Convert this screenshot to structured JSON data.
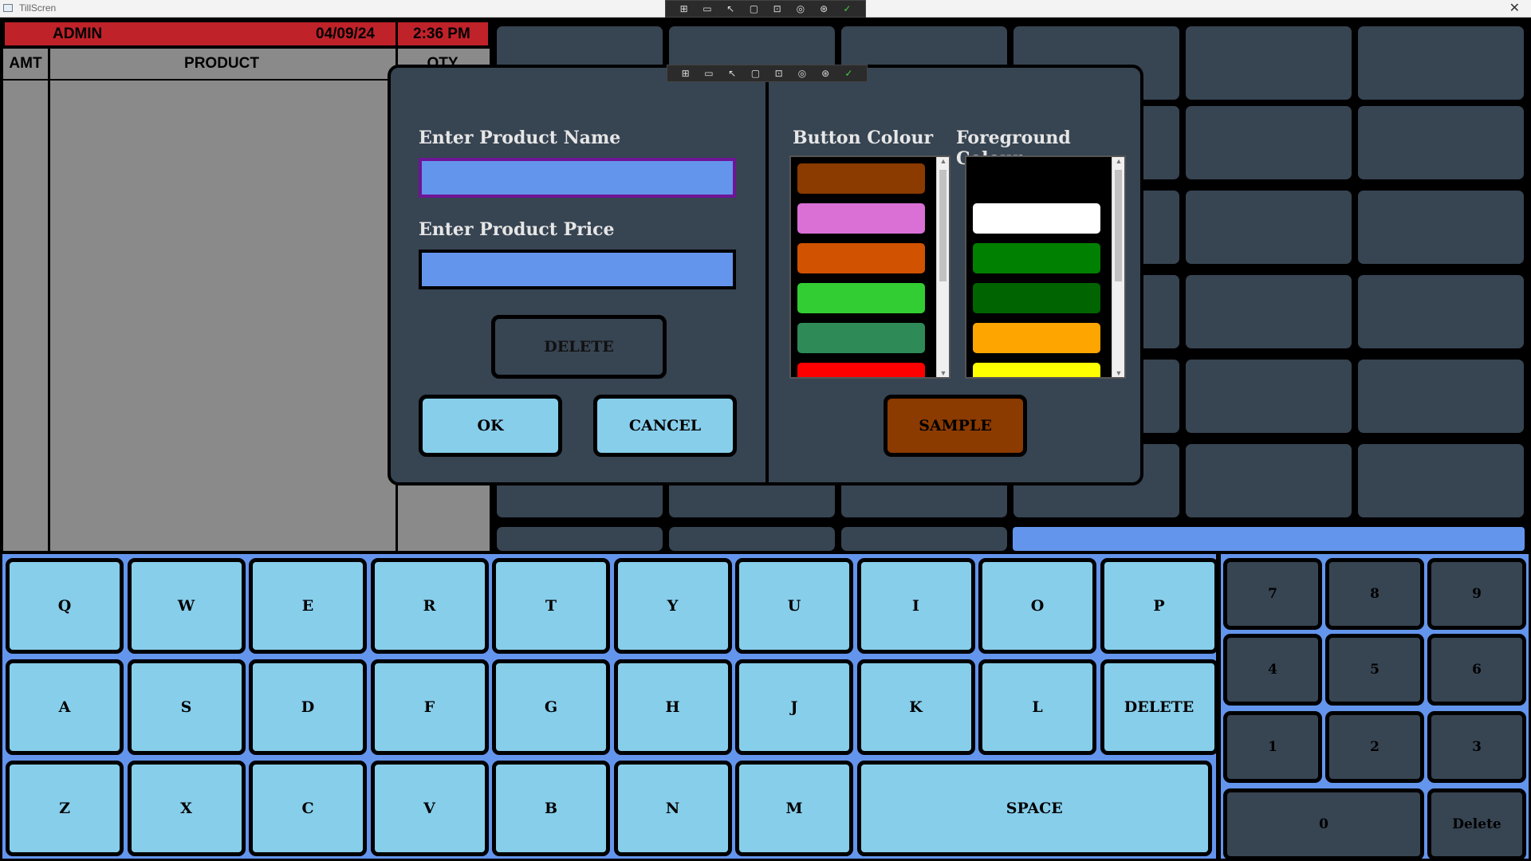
{
  "window": {
    "title": "TillScren",
    "close_glyph": "✕"
  },
  "devtools_bar": {
    "icons": [
      "⊞",
      "▭",
      "↖",
      "▢",
      "⊡",
      "◎",
      "⊛",
      "✓"
    ]
  },
  "header": {
    "user": "ADMIN",
    "date": "04/09/24",
    "time": "2:36 PM"
  },
  "table": {
    "col_amt": "AMT",
    "col_product": "PRODUCT",
    "col_qty": "QTY"
  },
  "dialog": {
    "name_label": "Enter Product Name",
    "name_value": "",
    "price_label": "Enter Product Price",
    "price_value": "",
    "delete_label": "DELETE",
    "ok_label": "OK",
    "cancel_label": "CANCEL",
    "button_colour_label": "Button Colour",
    "foreground_colour_label": "Foreground Colour",
    "sample_label": "SAMPLE",
    "sample_bg": "#8b3a00",
    "button_colours": [
      "#8b3a00",
      "#da70d6",
      "#d15200",
      "#32cd32",
      "#2e8b57",
      "#ff0000"
    ],
    "foreground_colours": [
      "#000000",
      "#ffffff",
      "#008000",
      "#006400",
      "#ffa500",
      "#ffff00"
    ]
  },
  "keyboard": {
    "row1": [
      "Q",
      "W",
      "E",
      "R",
      "T",
      "Y",
      "U",
      "I",
      "O",
      "P"
    ],
    "row2": [
      "A",
      "S",
      "D",
      "F",
      "G",
      "H",
      "J",
      "K",
      "L",
      "DELETE"
    ],
    "row3": [
      "Z",
      "X",
      "C",
      "V",
      "B",
      "N",
      "M"
    ],
    "space_label": "SPACE"
  },
  "numpad": {
    "row1": [
      "7",
      "8",
      "9"
    ],
    "row2": [
      "4",
      "5",
      "6"
    ],
    "row3": [
      "1",
      "2",
      "3"
    ],
    "zero": "0",
    "delete_label": "Delete"
  },
  "colors": {
    "accent_blue": "#6495ed",
    "key_blue": "#87ceeb",
    "tile": "#374452",
    "header_red": "#c0222a"
  }
}
